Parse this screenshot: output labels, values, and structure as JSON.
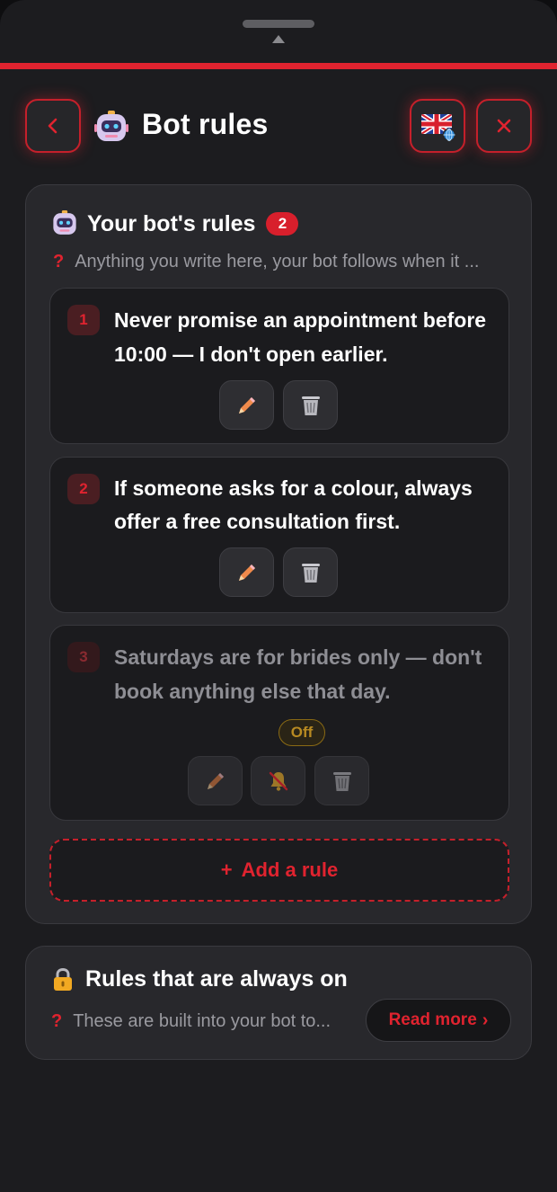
{
  "header": {
    "title": "Bot rules",
    "back_icon": "chevron-left-icon",
    "language_icon": "uk-flag-icon",
    "close_icon": "close-icon"
  },
  "rules_section": {
    "heading": "Your bot's rules",
    "active_count": "2",
    "hint": "Anything you write here, your bot follows when it ...",
    "rules": [
      {
        "number": "1",
        "text": "Never promise an appointment before 10:00 — I don't open earlier.",
        "enabled": true
      },
      {
        "number": "2",
        "text": "If someone asks for a colour, always offer a free consultation first.",
        "enabled": true
      },
      {
        "number": "3",
        "text": "Saturdays are for brides only — don't book anything else that day.",
        "enabled": false,
        "status_label": "Off"
      }
    ],
    "add_label": "Add a rule"
  },
  "always_on": {
    "heading": "Rules that are always on",
    "hint": "These are built into your bot to...",
    "read_more_label": "Read more"
  },
  "colors": {
    "accent": "#e0232f",
    "background": "#1c1c1f",
    "card": "#28282c",
    "off": "#b88a22"
  }
}
